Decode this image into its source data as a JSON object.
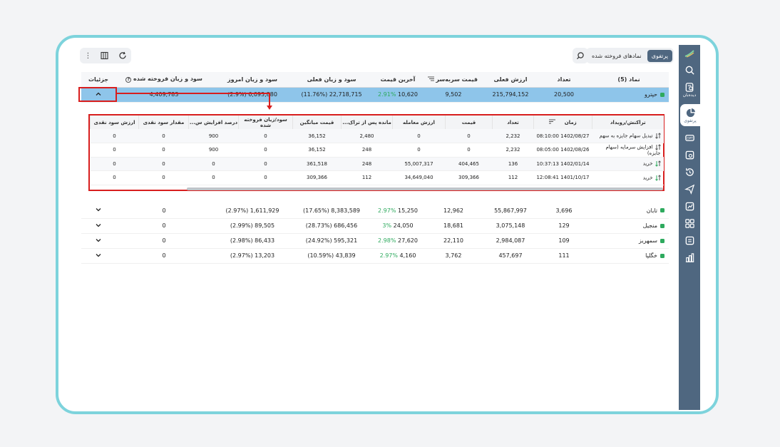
{
  "sidebar": {
    "items": [
      {
        "icon": "search-icon",
        "label": ""
      },
      {
        "icon": "watchlist-icon",
        "label": "دیده‌بان"
      },
      {
        "icon": "portfolio-icon",
        "label": "پرتفوی",
        "active": true
      },
      {
        "icon": "options-icon",
        "label": ""
      },
      {
        "icon": "orders-icon",
        "label": ""
      },
      {
        "icon": "history-icon",
        "label": ""
      },
      {
        "icon": "send-icon",
        "label": ""
      },
      {
        "icon": "chart-icon",
        "label": ""
      },
      {
        "icon": "grid-icon",
        "label": ""
      },
      {
        "icon": "calculator-icon",
        "label": ""
      },
      {
        "icon": "stats-icon",
        "label": ""
      }
    ]
  },
  "topbar": {
    "tabs": [
      {
        "label": "پرتفوی",
        "active": true
      },
      {
        "label": "نمادهای فروخته شده",
        "active": false
      }
    ]
  },
  "main_table": {
    "headers": [
      "نماد (5)",
      "تعداد",
      "ارزش فعلی",
      "قیمت سربه‌سر",
      "آخرین قیمت",
      "سود و زیان فعلی",
      "سود و زیان امروز",
      "سود و زیان فروخته شده",
      "جزئیات"
    ],
    "selected_row": {
      "symbol": "حپترو",
      "qty": "20,500",
      "value": "215,794,152",
      "breakeven": "9,502",
      "last_price": "10,620",
      "last_pct": "2.91%",
      "pnl": "22,718,715 (11.76%)",
      "today": "6,093,880 (2.9%)",
      "sold": "4,409,783"
    },
    "rows": [
      {
        "symbol": "تابان",
        "qty": "3,696",
        "value": "55,867,997",
        "breakeven": "12,962",
        "last_price": "15,250",
        "last_pct": "2.97%",
        "pnl": "8,383,589 (17.65%)",
        "today": "1,611,929 (2.97%)",
        "sold": "0"
      },
      {
        "symbol": "منجیل",
        "qty": "129",
        "value": "3,075,148",
        "breakeven": "18,681",
        "last_price": "24,050",
        "last_pct": "3%",
        "pnl": "686,456 (28.73%)",
        "today": "89,505 (2.99%)",
        "sold": "0"
      },
      {
        "symbol": "سمهریز",
        "qty": "109",
        "value": "2,984,087",
        "breakeven": "22,110",
        "last_price": "27,620",
        "last_pct": "2.98%",
        "pnl": "595,321 (24.92%)",
        "today": "86,433 (2.98%)",
        "sold": "0"
      },
      {
        "symbol": "خگلپا",
        "qty": "111",
        "value": "457,697",
        "breakeven": "3,762",
        "last_price": "4,160",
        "last_pct": "2.97%",
        "pnl": "43,839 (10.59%)",
        "today": "13,203 (2.97%)",
        "sold": "0"
      }
    ]
  },
  "detail_table": {
    "headers": [
      "تراکنش/رویداد",
      "زمان",
      "تعداد",
      "قیمت",
      "ارزش معامله",
      "مانده پس از تراک...",
      "قیمت میانگین",
      "سود/زیان فروخته شده",
      "درصد افزایش س...",
      "مقدار سود نقدی",
      "ارزش سود نقدی"
    ],
    "rows": [
      {
        "event": "تبدیل سهام جایزه به سهم",
        "buy": false,
        "time": "1402/08/27 08:10:00",
        "qty": "2,232",
        "price": "0",
        "trade_value": "0",
        "remaining": "2,480",
        "avg": "36,152",
        "sold_pnl": "0",
        "increase_pct": "900",
        "div_qty": "0",
        "div_value": "0"
      },
      {
        "event": "افزایش سرمایه (سهام جایزه)",
        "buy": false,
        "time": "1402/08/26 08:05:00",
        "qty": "2,232",
        "price": "0",
        "trade_value": "0",
        "remaining": "248",
        "avg": "36,152",
        "sold_pnl": "0",
        "increase_pct": "900",
        "div_qty": "0",
        "div_value": "0"
      },
      {
        "event": "خرید",
        "buy": true,
        "time": "1402/01/14 10:37:13",
        "qty": "136",
        "price": "404,465",
        "trade_value": "55,007,317",
        "remaining": "248",
        "avg": "361,518",
        "sold_pnl": "0",
        "increase_pct": "0",
        "div_qty": "0",
        "div_value": "0"
      },
      {
        "event": "خرید",
        "buy": true,
        "time": "1401/10/17 12:08:41",
        "qty": "112",
        "price": "309,366",
        "trade_value": "34,649,040",
        "remaining": "112",
        "avg": "309,366",
        "sold_pnl": "0",
        "increase_pct": "0",
        "div_qty": "0",
        "div_value": "0"
      }
    ]
  },
  "colors": {
    "accent": "#4f6780",
    "selected": "#8ec5ea",
    "positive": "#2eaa5e",
    "highlight": "#d81e1e",
    "frame": "#7dd3dc"
  }
}
